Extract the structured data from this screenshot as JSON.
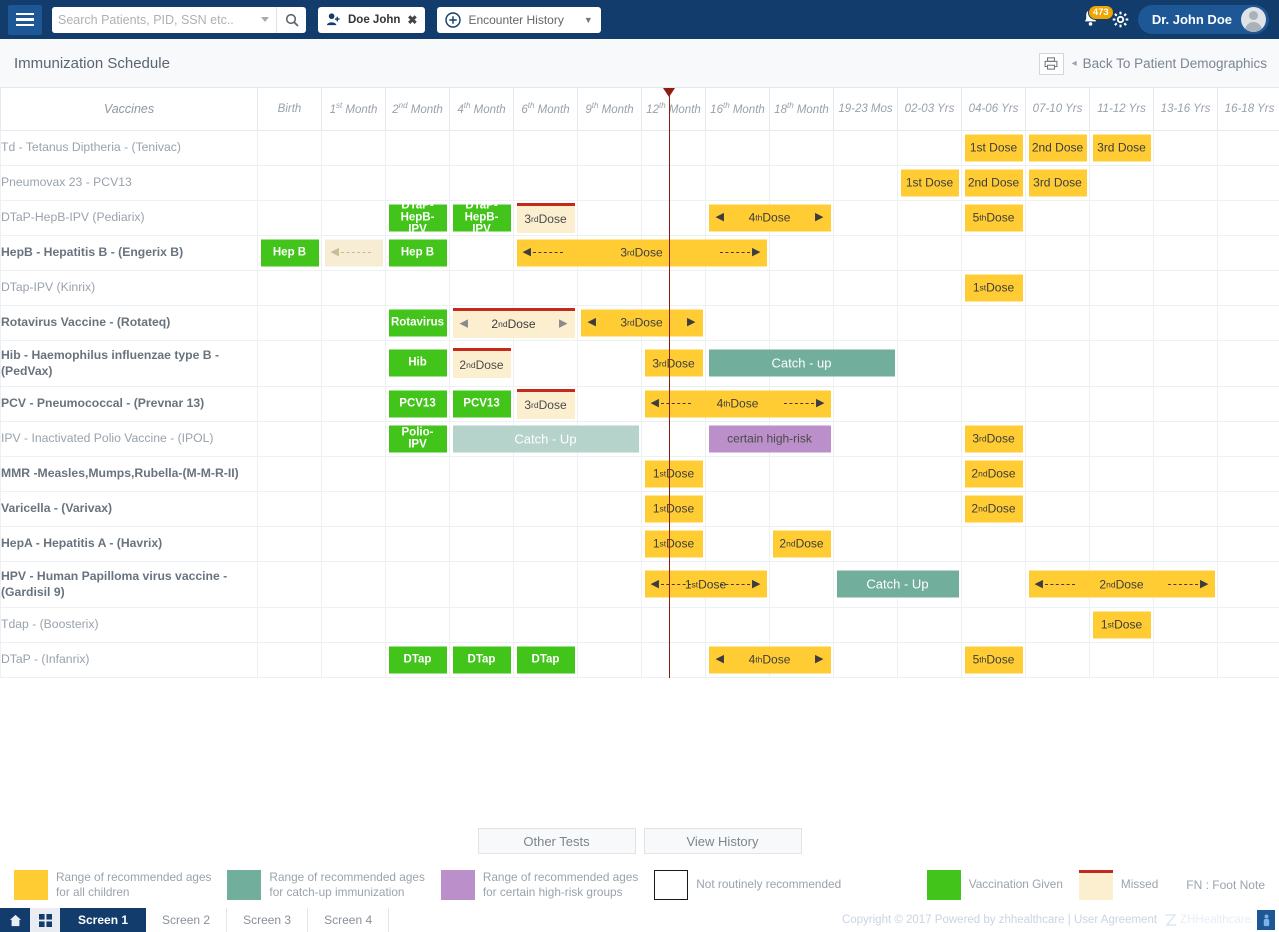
{
  "topbar": {
    "menu_icon": "hamburger-icon",
    "search": {
      "placeholder": "Search Patients, PID, SSN etc..",
      "value": ""
    },
    "search_icon": "search-icon",
    "patient_chip": {
      "icon": "add-user-icon",
      "label": "Doe John",
      "close": "✖"
    },
    "encounter_chip": {
      "icon": "plus-circle-icon",
      "label": "Encounter History",
      "caret": "▼"
    },
    "notification_count": "473",
    "gear_icon": "gear-icon",
    "user_name": "Dr. John Doe"
  },
  "titlebar": {
    "title": "Immunization Schedule",
    "print_icon": "printer-icon",
    "back_arrow": "◂",
    "back_label": "Back To Patient Demographics"
  },
  "table": {
    "columns": [
      "Vaccines",
      "Birth",
      "1st Month",
      "2nd Month",
      "4th Month",
      "6th Month",
      "9th Month",
      "12th Month",
      "16th Month",
      "18th Month",
      "19-23 Mos",
      "02-03 Yrs",
      "04-06 Yrs",
      "07-10 Yrs",
      "11-12 Yrs",
      "13-16 Yrs",
      "16-18 Yrs"
    ],
    "column_sup": [
      "",
      "",
      "st",
      "nd",
      "th",
      "th",
      "th",
      "th",
      "th",
      "th",
      "",
      "",
      "",
      "",
      "",
      "",
      ""
    ],
    "column_base": [
      "Vaccines",
      "Birth",
      "1",
      "2",
      "4",
      "6",
      "9",
      "12",
      "16",
      "18",
      "19-23 Mos",
      "02-03 Yrs",
      "04-06 Yrs",
      "07-10 Yrs",
      "11-12 Yrs",
      "13-16 Yrs",
      "16-18 Yrs"
    ],
    "column_tail": [
      "",
      "",
      " Month",
      " Month",
      " Month",
      " Month",
      " Month",
      " Month",
      " Month",
      " Month",
      "",
      "",
      "",
      "",
      "",
      "",
      ""
    ],
    "rows": [
      {
        "name": "Td - Tetanus Diptheria - (Tenivac)",
        "bold": false
      },
      {
        "name": "Pneumovax 23 - PCV13",
        "bold": false
      },
      {
        "name": "DTaP-HepB-IPV (Pediarix)",
        "bold": false
      },
      {
        "name": "HepB - Hepatitis B - (Engerix B)",
        "bold": true
      },
      {
        "name": "DTap-IPV (Kinrix)",
        "bold": false
      },
      {
        "name": "Rotavirus Vaccine - (Rotateq)",
        "bold": true
      },
      {
        "name": "Hib - Haemophilus influenzae type B - (PedVax)",
        "bold": true
      },
      {
        "name": "PCV - Pneumococcal - (Prevnar 13)",
        "bold": true
      },
      {
        "name": "IPV - Inactivated Polio Vaccine - (IPOL)",
        "bold": false
      },
      {
        "name": "MMR -Measles,Mumps,Rubella-(M-M-R-II)",
        "bold": true
      },
      {
        "name": "Varicella -  (Varivax)",
        "bold": true
      },
      {
        "name": "HepA - Hepatitis A - (Havrix)",
        "bold": true
      },
      {
        "name": "HPV - Human Papilloma virus vaccine - (Gardisil 9)",
        "bold": true
      },
      {
        "name": "Tdap - (Boosterix)",
        "bold": false
      },
      {
        "name": "DTaP - (Infanrix)",
        "bold": false
      }
    ],
    "cells": {
      "td_tetanus": [
        {
          "col": 12,
          "label": "1st Dose",
          "kind": "yellow"
        },
        {
          "col": 13,
          "label": "2nd Dose",
          "kind": "yellow"
        },
        {
          "col": 14,
          "label": "3rd Dose",
          "kind": "yellow"
        }
      ],
      "pneumovax": [
        {
          "col": 11,
          "label": "1st Dose",
          "kind": "yellow"
        },
        {
          "col": 12,
          "label": "2nd Dose",
          "kind": "yellow"
        },
        {
          "col": 13,
          "label": "3rd Dose",
          "kind": "yellow"
        }
      ],
      "dtap_hepb_ipv": [
        {
          "col": 3,
          "label": "DTaP-HepB-IPV",
          "kind": "given"
        },
        {
          "col": 4,
          "label": "DTaP-HepB-IPV",
          "kind": "given"
        },
        {
          "col": 5,
          "base": "3",
          "sup": "rd",
          "tail": " Dose",
          "kind": "missed"
        },
        {
          "span": [
            8,
            9
          ],
          "base": "4",
          "sup": "th",
          "tail": " Dose",
          "kind": "yellow-range"
        },
        {
          "col": 12,
          "base": "5",
          "sup": "th",
          "tail": " Dose",
          "kind": "yellow"
        }
      ],
      "hepb": [
        {
          "col": 1,
          "label": "Hep B",
          "kind": "given"
        },
        {
          "col": 2,
          "label": "",
          "kind": "beige-arrow-left"
        },
        {
          "col": 3,
          "label": "Hep B",
          "kind": "given"
        },
        {
          "span": [
            5,
            8
          ],
          "base": "3",
          "sup": "rd",
          "tail": " Dose",
          "kind": "yellow-dash-range"
        }
      ],
      "dtap_ipv": [
        {
          "col": 12,
          "base": "1",
          "sup": "st",
          "tail": " Dose",
          "kind": "yellow"
        }
      ],
      "rotavirus": [
        {
          "col": 3,
          "label": "Rotavirus",
          "kind": "given"
        },
        {
          "span": [
            4,
            5
          ],
          "base": "2",
          "sup": "nd",
          "tail": " Dose",
          "kind": "missed-range"
        },
        {
          "span": [
            6,
            7
          ],
          "base": "3",
          "sup": "rd",
          "tail": " Dose",
          "kind": "yellow-range"
        }
      ],
      "hib": [
        {
          "col": 3,
          "label": "Hib",
          "kind": "given"
        },
        {
          "col": 4,
          "base": "2",
          "sup": "nd",
          "tail": " Dose",
          "kind": "missed"
        },
        {
          "col": 7,
          "base": "3",
          "sup": "rd",
          "tail": " Dose",
          "kind": "yellow"
        },
        {
          "span": [
            8,
            10
          ],
          "label": "Catch - up",
          "kind": "catchup"
        }
      ],
      "pcv": [
        {
          "col": 3,
          "label": "PCV13",
          "kind": "given"
        },
        {
          "col": 4,
          "label": "PCV13",
          "kind": "given"
        },
        {
          "col": 5,
          "base": "3",
          "sup": "rd",
          "tail": " Dose",
          "kind": "missed"
        },
        {
          "span": [
            7,
            9
          ],
          "base": "4",
          "sup": "th",
          "tail": " Dose",
          "kind": "yellow-dash-range"
        }
      ],
      "ipv": [
        {
          "col": 3,
          "label": "Polio-IPV",
          "kind": "given"
        },
        {
          "span": [
            4,
            6
          ],
          "label": "Catch - Up",
          "kind": "catchup-light"
        },
        {
          "span": [
            8,
            9
          ],
          "label": "certain high-risk",
          "kind": "highrisk"
        },
        {
          "col": 12,
          "base": "3",
          "sup": "rd",
          "tail": " Dose",
          "kind": "yellow"
        }
      ],
      "mmr": [
        {
          "col": 7,
          "base": "1",
          "sup": "st",
          "tail": " Dose",
          "kind": "yellow"
        },
        {
          "col": 12,
          "base": "2",
          "sup": "nd",
          "tail": " Dose",
          "kind": "yellow"
        }
      ],
      "varicella": [
        {
          "col": 7,
          "base": "1",
          "sup": "st",
          "tail": " Dose",
          "kind": "yellow"
        },
        {
          "col": 12,
          "base": "2",
          "sup": "nd",
          "tail": " Dose",
          "kind": "yellow"
        }
      ],
      "hepa": [
        {
          "col": 7,
          "base": "1",
          "sup": "st",
          "tail": " Dose",
          "kind": "yellow"
        },
        {
          "col": 9,
          "base": "2",
          "sup": "nd",
          "tail": " Dose",
          "kind": "yellow"
        }
      ],
      "hpv": [
        {
          "span": [
            7,
            8
          ],
          "base": "1",
          "sup": "st",
          "tail": " Dose",
          "kind": "yellow-dash-range"
        },
        {
          "span": [
            10,
            11
          ],
          "label": "Catch - Up",
          "kind": "catchup"
        },
        {
          "span": [
            13,
            15
          ],
          "base": "2",
          "sup": "nd",
          "tail": " Dose",
          "kind": "yellow-dash-range"
        }
      ],
      "tdap": [
        {
          "col": 14,
          "base": "1",
          "sup": "st",
          "tail": " Dose",
          "kind": "yellow"
        }
      ],
      "dtap": [
        {
          "col": 3,
          "label": "DTap",
          "kind": "given"
        },
        {
          "col": 4,
          "label": "DTap",
          "kind": "given"
        },
        {
          "col": 5,
          "label": "DTap",
          "kind": "given"
        },
        {
          "span": [
            8,
            9
          ],
          "base": "4",
          "sup": "th",
          "tail": " Dose",
          "kind": "yellow-range"
        },
        {
          "col": 12,
          "base": "5",
          "sup": "th",
          "tail": " Dose",
          "kind": "yellow"
        }
      ]
    }
  },
  "actions": {
    "other_tests": "Other Tests",
    "view_history": "View History"
  },
  "legend": {
    "items": [
      {
        "swatch": "yellow",
        "color": "#fc3",
        "line1": "Range of recommended ages",
        "line2": "for all children"
      },
      {
        "swatch": "teal",
        "color": "#71ae9c",
        "line1": "Range of recommended ages",
        "line2": "for catch-up immunization"
      },
      {
        "swatch": "purple",
        "color": "#bb8fc9",
        "line1": "Range of recommended ages",
        "line2": "for certain high-risk groups"
      },
      {
        "swatch": "none",
        "color": "#ffffff",
        "line1": "Not routinely recommended",
        "line2": ""
      }
    ],
    "right_items": [
      {
        "swatch": "green",
        "color": "#42c41a",
        "label": "Vaccination Given"
      },
      {
        "swatch": "missed",
        "color": "#fbefd0",
        "label": "Missed"
      }
    ],
    "footnote": "FN : Foot Note"
  },
  "taskbar": {
    "home_icon": "home-icon",
    "apps_icon": "grid-icon",
    "screens": [
      "Screen 1",
      "Screen 2",
      "Screen 3",
      "Screen 4"
    ],
    "active_screen": 0,
    "copyright": "Copyright © 2017 Powered by zhhealthcare | User Agreement",
    "brand": "ZHHealthcare"
  },
  "colors": {
    "navy": "#123c6b",
    "yellow": "#fc3",
    "green": "#42c41a",
    "teal": "#71ae9c",
    "purple": "#bb8fc9",
    "missed_bg": "#fbefd0",
    "missed_border": "#c42a1c",
    "marker_red": "#8d1c12"
  }
}
